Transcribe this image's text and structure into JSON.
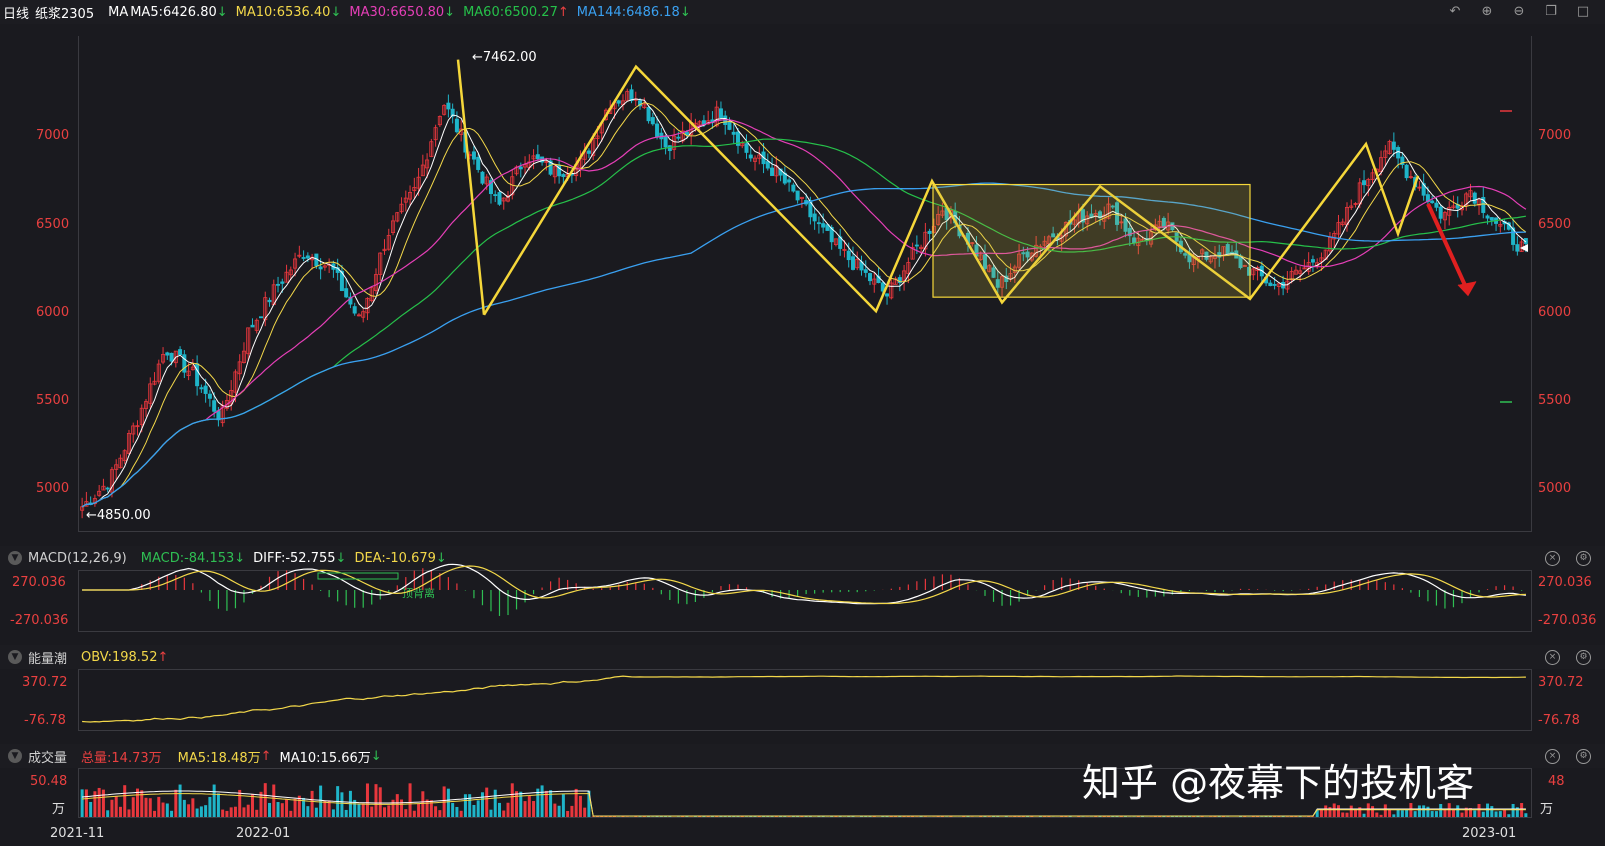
{
  "colors": {
    "up": "#e8373d",
    "down": "#1fb5c9",
    "ma5": "#ffffff",
    "ma10": "#f3d84a",
    "ma30": "#e53fb7",
    "ma60": "#26c04a",
    "ma144": "#3aa0f0",
    "yellow": "#f5d73a",
    "green": "#2fbf53",
    "axis": "#e94040"
  },
  "header": {
    "period": "日线",
    "symbol": "纸浆2305",
    "ma_prefix": "MA",
    "ma5": "MA5:6426.80",
    "ma10": "MA10:6536.40",
    "ma30": "MA30:6650.80",
    "ma60": "MA60:6500.27",
    "ma144": "MA144:6486.18",
    "arrow_down": "↓",
    "arrow_up": "↑",
    "icons": [
      "undo-icon",
      "zoom-in-icon",
      "zoom-out-icon",
      "window-icon",
      "maximize-icon"
    ]
  },
  "price_axis": {
    "ticks": [
      "7000",
      "6500",
      "6000",
      "5500",
      "5000"
    ]
  },
  "annotations": {
    "high": "←7462.00",
    "low": "←4850.00"
  },
  "macd": {
    "title": "MACD(12,26,9)",
    "macd": "MACD:-84.153",
    "diff": "DIFF:-52.755",
    "dea": "DEA:-10.679",
    "top": "270.036",
    "bottom": "-270.036",
    "top_r": "270.036",
    "bottom_r": "-270.036",
    "note": "顶背离"
  },
  "obv": {
    "title": "能量潮",
    "obv": "OBV:198.52",
    "top": "370.72",
    "bottom": "-76.78",
    "top_r": "370.72",
    "bottom_r": "-76.78"
  },
  "volume": {
    "title": "成交量",
    "total": "总量:14.73万",
    "ma5": "MA5:18.48万",
    "ma10": "MA10:15.66万",
    "top": "50.48",
    "unit": "万",
    "top_r": "48",
    "unit_r": "万"
  },
  "dates": [
    "2021-11",
    "2022-01",
    "2023-01"
  ],
  "watermark": "知乎 @夜幕下的投机客",
  "chart_data": {
    "type": "candlestick",
    "symbol": "纸浆2305",
    "y_ticks": [
      5000,
      5500,
      6000,
      6500,
      7000
    ],
    "ylim": [
      4800,
      7520
    ],
    "high": 7462.0,
    "low": 4850.0,
    "close_path": [
      4900,
      5050,
      5400,
      5800,
      5650,
      5400,
      5900,
      6150,
      6350,
      6250,
      5950,
      6450,
      6700,
      7200,
      6900,
      6600,
      6900,
      6800,
      6850,
      7200,
      7250,
      6950,
      7050,
      7150,
      6900,
      6800,
      6600,
      6400,
      6250,
      6100,
      6350,
      6600,
      6400,
      6150,
      6350,
      6450,
      6550,
      6600,
      6400,
      6500,
      6300,
      6350,
      6250,
      6150,
      6250,
      6400,
      6700,
      6950,
      6750,
      6550,
      6700,
      6500,
      6350
    ],
    "ma_last": {
      "MA5": 6426.8,
      "MA10": 6536.4,
      "MA30": 6650.8,
      "MA60": 6500.27,
      "MA144": 6486.18
    },
    "macd_last": {
      "MACD": -84.153,
      "DIFF": -52.755,
      "DEA": -10.679
    },
    "obv_last": 198.52,
    "volume_last": {
      "total": 14.73,
      "MA5": 18.48,
      "MA10": 15.66
    }
  }
}
